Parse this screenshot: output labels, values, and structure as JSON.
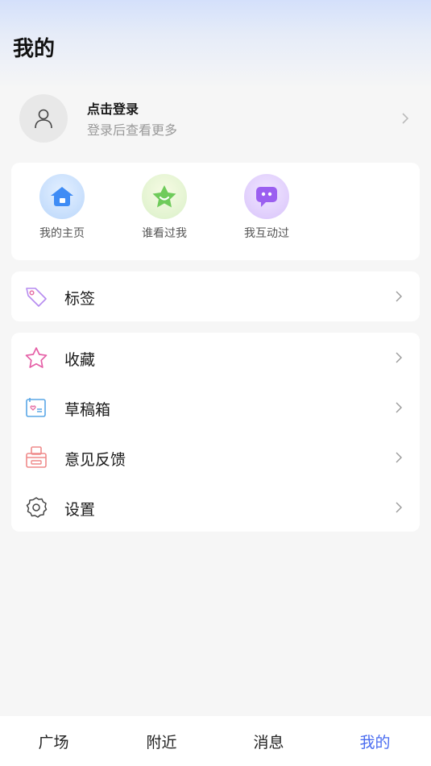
{
  "header": {
    "title": "我的"
  },
  "profile": {
    "name": "点击登录",
    "subtitle": "登录后查看更多",
    "avatar_icon": "user-icon"
  },
  "quick_actions": [
    {
      "label": "我的主页",
      "icon": "home-icon",
      "color": "#4a8cf7"
    },
    {
      "label": "谁看过我",
      "icon": "star-face-icon",
      "color": "#6cc95a"
    },
    {
      "label": "我互动过",
      "icon": "chat-bubble-icon",
      "color": "#9a63ec"
    }
  ],
  "menu_single": [
    {
      "label": "标签",
      "icon": "tag-icon"
    }
  ],
  "menu_group": [
    {
      "label": "收藏",
      "icon": "star-icon"
    },
    {
      "label": "草稿箱",
      "icon": "draft-icon"
    },
    {
      "label": "意见反馈",
      "icon": "feedback-icon"
    },
    {
      "label": "设置",
      "icon": "gear-icon"
    }
  ],
  "tabs": [
    {
      "label": "广场",
      "active": false
    },
    {
      "label": "附近",
      "active": false
    },
    {
      "label": "消息",
      "active": false
    },
    {
      "label": "我的",
      "active": true
    }
  ],
  "colors": {
    "accent": "#4a6cf0",
    "background": "#f6f6f6"
  }
}
